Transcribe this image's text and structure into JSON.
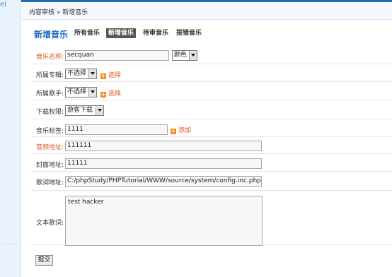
{
  "sidebar": {
    "partial_text": "el"
  },
  "breadcrumb": {
    "text": "内容审核 » 新增音乐"
  },
  "heading": "新增音乐",
  "tabs": [
    {
      "label": "所有音乐",
      "active": false
    },
    {
      "label": "新增音乐",
      "active": true
    },
    {
      "label": "待审音乐",
      "active": false
    },
    {
      "label": "报错音乐",
      "active": false
    }
  ],
  "form": {
    "music_name": {
      "label": "音乐名称:",
      "value": "secquan",
      "color_select": "颜色"
    },
    "album": {
      "label": "所属专辑:",
      "select": "不选择",
      "action": "选择"
    },
    "singer": {
      "label": "所属歌手:",
      "select": "不选择",
      "action": "选择"
    },
    "download": {
      "label": "下载权限:",
      "select": "游客下载"
    },
    "tags": {
      "label": "音乐标签:",
      "value": "1111",
      "action": "添加"
    },
    "audio_url": {
      "label": "音频地址:",
      "value": "111111"
    },
    "cover_url": {
      "label": "封面地址:",
      "value": "11111"
    },
    "lyrics_url": {
      "label": "歌词地址:",
      "value": "C:/phpStudy/PHPTutorial/WWW/source/system/config.inc.php"
    },
    "lyrics_text": {
      "label": "文本歌词:",
      "value": "test hacker"
    }
  },
  "submit_label": "提交",
  "colors": {
    "accent": "#1a6fc0",
    "required_label": "#e0561d",
    "action_icon": "#f08a1c"
  }
}
